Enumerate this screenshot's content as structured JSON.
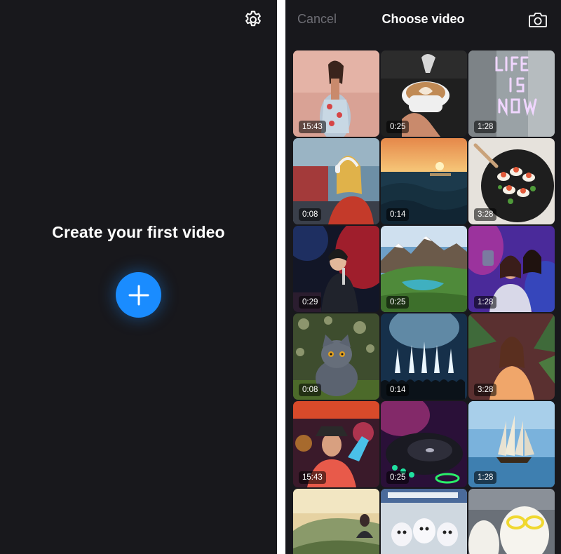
{
  "left": {
    "empty_title": "Create your first video",
    "settings_icon": "gear-icon",
    "create_icon": "plus-icon",
    "accent_color": "#1a8cff"
  },
  "picker": {
    "cancel_label": "Cancel",
    "title": "Choose video",
    "camera_icon": "camera-icon",
    "videos": [
      {
        "subject": "woman-floral-dress",
        "duration": "15:43"
      },
      {
        "subject": "latte-art-coffee",
        "duration": "0:25"
      },
      {
        "subject": "neon-sign-life-is-now",
        "duration": "1:28"
      },
      {
        "subject": "woman-headphones",
        "duration": "0:08"
      },
      {
        "subject": "ocean-sunset",
        "duration": "0:14"
      },
      {
        "subject": "food-plate",
        "duration": "3:28"
      },
      {
        "subject": "singer-on-stage",
        "duration": "0:29"
      },
      {
        "subject": "mountain-lake",
        "duration": "0:25"
      },
      {
        "subject": "friends-selfie-party",
        "duration": "1:28"
      },
      {
        "subject": "gray-cat",
        "duration": "0:08"
      },
      {
        "subject": "concert-crowd",
        "duration": "0:14"
      },
      {
        "subject": "woman-tropical-leaves",
        "duration": "3:28"
      },
      {
        "subject": "man-hat-neon",
        "duration": "15:43"
      },
      {
        "subject": "dj-turntable",
        "duration": "0:25"
      },
      {
        "subject": "sailing-ship",
        "duration": "1:28"
      },
      {
        "subject": "woman-hillside",
        "duration": null
      },
      {
        "subject": "mascot-figures",
        "duration": null
      },
      {
        "subject": "dog-sunglasses",
        "duration": null
      }
    ]
  }
}
